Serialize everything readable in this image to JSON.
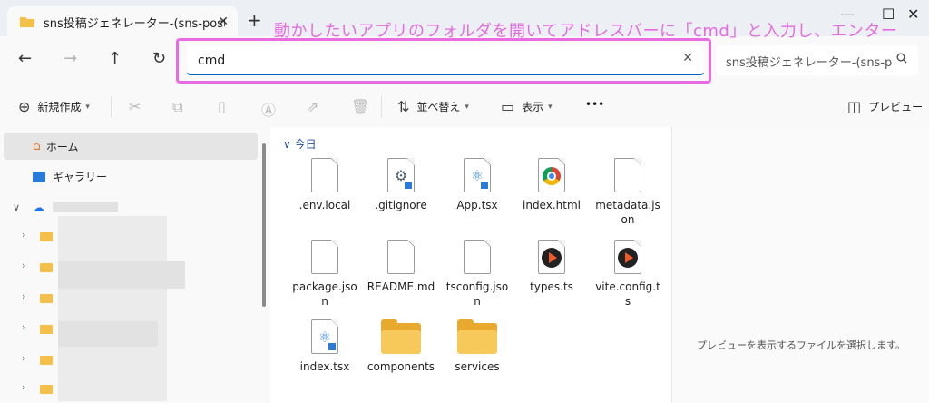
{
  "window": {
    "tab_title": "sns投稿ジェネレーター-(sns-post-g",
    "tab_close": "✕",
    "new_tab": "+",
    "minimize": "—",
    "maximize": "☐",
    "close": "✕"
  },
  "annotation": "動かしたいアプリのフォルダを開いてアドレスバーに「cmd」と入力し、エンター",
  "nav": {
    "back": "←",
    "forward": "→",
    "up": "↑",
    "refresh": "↻"
  },
  "address": {
    "value": "cmd",
    "clear": "✕"
  },
  "search": {
    "placeholder": "sns投稿ジェネレーター-(sns-p",
    "icon": "⚲"
  },
  "toolbar": {
    "new_label": "新規作成",
    "sort_label": "並べ替え",
    "view_label": "表示",
    "more": "•••",
    "preview_label": "プレビュー"
  },
  "sidebar": {
    "home": "ホーム",
    "gallery": "ギャラリー"
  },
  "files": {
    "group": "今日",
    "items": [
      {
        "name": ".env.local",
        "icon": "doc"
      },
      {
        "name": ".gitignore",
        "icon": "gear-doc"
      },
      {
        "name": "App.tsx",
        "icon": "react-doc"
      },
      {
        "name": "index.html",
        "icon": "chrome"
      },
      {
        "name": "metadata.json",
        "icon": "doc"
      },
      {
        "name": "package.json",
        "icon": "doc"
      },
      {
        "name": "README.md",
        "icon": "doc"
      },
      {
        "name": "tsconfig.json",
        "icon": "doc"
      },
      {
        "name": "types.ts",
        "icon": "play"
      },
      {
        "name": "vite.config.ts",
        "icon": "play"
      },
      {
        "name": "index.tsx",
        "icon": "react-doc"
      },
      {
        "name": "components",
        "icon": "folder"
      },
      {
        "name": "services",
        "icon": "folder"
      }
    ]
  },
  "preview": {
    "message": "プレビューを表示するファイルを選択します。"
  },
  "colors": {
    "accent": "#0067c0",
    "annotation": "#e36be0",
    "folder": "#f5c04a"
  }
}
